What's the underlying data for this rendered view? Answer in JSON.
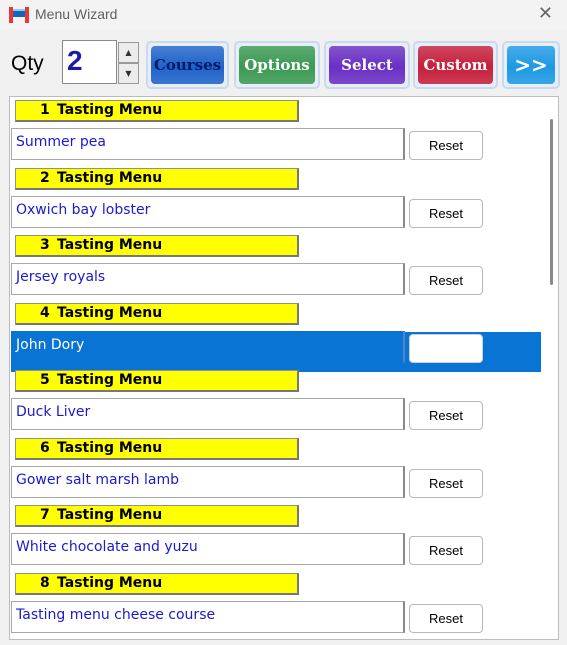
{
  "window": {
    "title": "Menu Wizard",
    "close_glyph": "✕"
  },
  "toolbar": {
    "qty_label": "Qty",
    "qty_value": "2",
    "buttons": [
      {
        "label": "Courses",
        "color": "#1f63c9"
      },
      {
        "label": "Options",
        "color": "#3b9a52"
      },
      {
        "label": "Select",
        "color": "#6a2fc4"
      },
      {
        "label": "Custom",
        "color": "#c71f3a"
      },
      {
        "label": ">>",
        "color": "#1d9ae3"
      }
    ]
  },
  "courses": [
    {
      "number": "1",
      "header": "Tasting Menu",
      "dish": "Summer pea",
      "reset_label": "Reset",
      "selected": false
    },
    {
      "number": "2",
      "header": "Tasting Menu",
      "dish": "Oxwich bay lobster",
      "reset_label": "Reset",
      "selected": false
    },
    {
      "number": "3",
      "header": "Tasting Menu",
      "dish": "Jersey royals",
      "reset_label": "Reset",
      "selected": false
    },
    {
      "number": "4",
      "header": "Tasting Menu",
      "dish": "John Dory",
      "reset_label": "",
      "selected": true
    },
    {
      "number": "5",
      "header": "Tasting Menu",
      "dish": "Duck Liver",
      "reset_label": "Reset",
      "selected": false
    },
    {
      "number": "6",
      "header": "Tasting Menu",
      "dish": "Gower salt marsh lamb",
      "reset_label": "Reset",
      "selected": false
    },
    {
      "number": "7",
      "header": "Tasting Menu",
      "dish": "White chocolate and yuzu",
      "reset_label": "Reset",
      "selected": false
    },
    {
      "number": "8",
      "header": "Tasting Menu",
      "dish": "Tasting menu cheese course",
      "reset_label": "Reset",
      "selected": false
    }
  ],
  "colors": {
    "header_bar": "#ffff00",
    "dish_text": "#1a1acc",
    "selection": "#0a74d4"
  }
}
